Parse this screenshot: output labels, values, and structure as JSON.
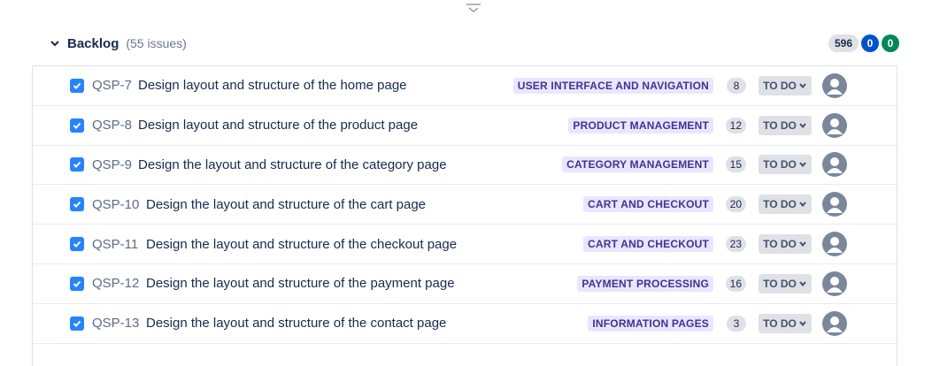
{
  "backlog": {
    "title": "Backlog",
    "count": "(55 issues)",
    "totals": {
      "todo": "596",
      "in_progress": "0",
      "done": "0"
    }
  },
  "colors": {
    "checkbox": "#2684ff",
    "epic_bg": "#eae6ff",
    "epic_text": "#403294",
    "pill_blue": "#0052cc",
    "pill_green": "#00875a"
  },
  "icons": {
    "drag": "drag-handle-icon",
    "chevron": "chevron-down-icon",
    "checkbox": "checkbox-checked-icon",
    "status": "chevron-down-icon",
    "avatar": "user-avatar-icon"
  },
  "issues": [
    {
      "key": "QSP-7",
      "summary": "Design layout and structure of the home page",
      "epic": "USER INTERFACE AND NAVIGATION",
      "points": "8",
      "status": "TO DO"
    },
    {
      "key": "QSP-8",
      "summary": "Design layout and structure of the product page",
      "epic": "PRODUCT MANAGEMENT",
      "points": "12",
      "status": "TO DO"
    },
    {
      "key": "QSP-9",
      "summary": "Design the layout and structure of the category page",
      "epic": "CATEGORY MANAGEMENT",
      "points": "15",
      "status": "TO DO"
    },
    {
      "key": "QSP-10",
      "summary": "Design the layout and structure of the cart page",
      "epic": "CART AND CHECKOUT",
      "points": "20",
      "status": "TO DO"
    },
    {
      "key": "QSP-11",
      "summary": "Design the layout and structure of the checkout page",
      "epic": "CART AND CHECKOUT",
      "points": "23",
      "status": "TO DO"
    },
    {
      "key": "QSP-12",
      "summary": "Design the layout and structure of the payment page",
      "epic": "PAYMENT PROCESSING",
      "points": "16",
      "status": "TO DO"
    },
    {
      "key": "QSP-13",
      "summary": "Design the layout and structure of the contact page",
      "epic": "INFORMATION PAGES",
      "points": "3",
      "status": "TO DO"
    }
  ]
}
